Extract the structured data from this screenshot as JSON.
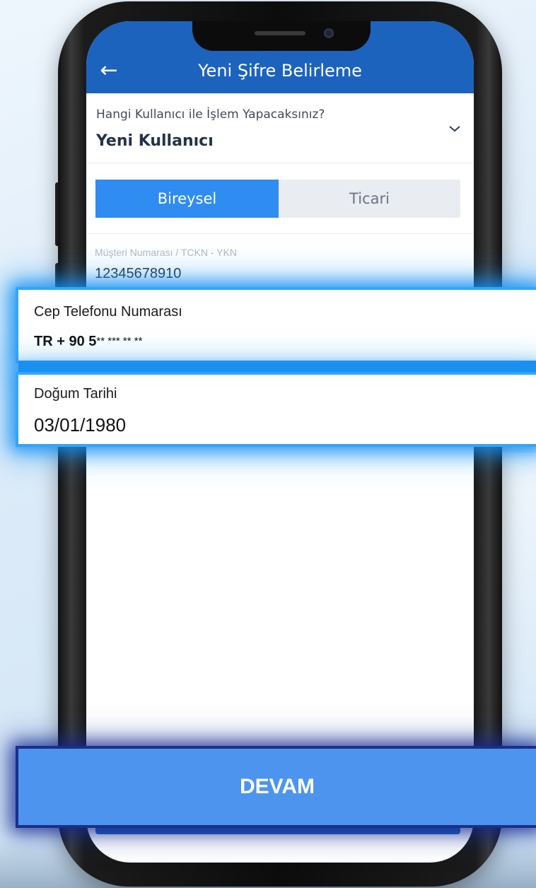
{
  "header": {
    "title": "Yeni Şifre Belirleme",
    "back_icon": "←"
  },
  "user_select": {
    "question": "Hangi Kullanıcı ile İşlem Yapacaksınız?",
    "value": "Yeni Kullanıcı",
    "chevron_icon": "⌄"
  },
  "segment": {
    "options": [
      "Bireysel",
      "Ticari"
    ],
    "selected": "Bireysel"
  },
  "customer": {
    "label": "Müşteri Numarası / TCKN - YKN",
    "value": "12345678910"
  },
  "phone": {
    "label": "Cep Telefonu Numarası",
    "prefix": "TR + 90 5",
    "masked": "** *** ** **"
  },
  "birth": {
    "label": "Doğum Tarihi",
    "value": "03/01/1980"
  },
  "actions": {
    "continue_label": "DEVAM"
  },
  "colors": {
    "appbar": "#1c63bd",
    "segment_active": "#2f8cf0",
    "highlight_glow": "#1f8ff0",
    "button": "#4d94ef",
    "button_glow": "#1b2f8a"
  }
}
